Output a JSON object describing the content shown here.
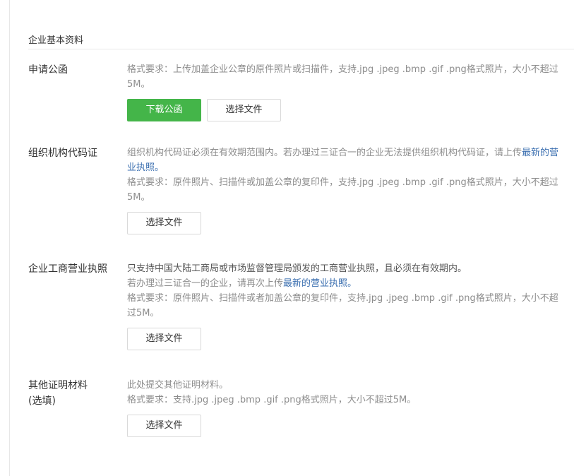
{
  "section": {
    "title": "企业基本资料"
  },
  "rows": [
    {
      "label": "申请公函",
      "lines": [
        "格式要求：上传加盖企业公章的原件照片或扫描件，支持.jpg .jpeg .bmp .gif .png格式照片，大小不超过5M。"
      ],
      "primary_button": "下载公函",
      "file_button": "选择文件"
    },
    {
      "label": "组织机构代码证",
      "line1_prefix": "组织机构代码证必须在有效期范围内。若办理过三证合一的企业无法提供组织机构代码证，请上传",
      "line1_link": "最新的营业执照。",
      "line2": "格式要求：原件照片、扫描件或加盖公章的复印件，支持.jpg .jpeg .bmp .gif .png格式照片，大小不超过5M。",
      "file_button": "选择文件"
    },
    {
      "label": "企业工商营业执照",
      "line1": "只支持中国大陆工商局或市场监督管理局颁发的工商营业执照，且必须在有效期内。",
      "line2_prefix": "若办理过三证合一的企业，请再次上传",
      "line2_link": "最新的营业执照。",
      "line3": "格式要求：原件照片、扫描件或者加盖公章的复印件，支持.jpg .jpeg .bmp .gif .png格式照片，大小不超过5M。",
      "file_button": "选择文件"
    },
    {
      "label_line1": "其他证明材料",
      "label_line2": "(选填)",
      "line1": "此处提交其他证明材料。",
      "line2": "格式要求：支持.jpg .jpeg .bmp .gif .png格式照片，大小不超过5M。",
      "file_button": "选择文件"
    }
  ]
}
